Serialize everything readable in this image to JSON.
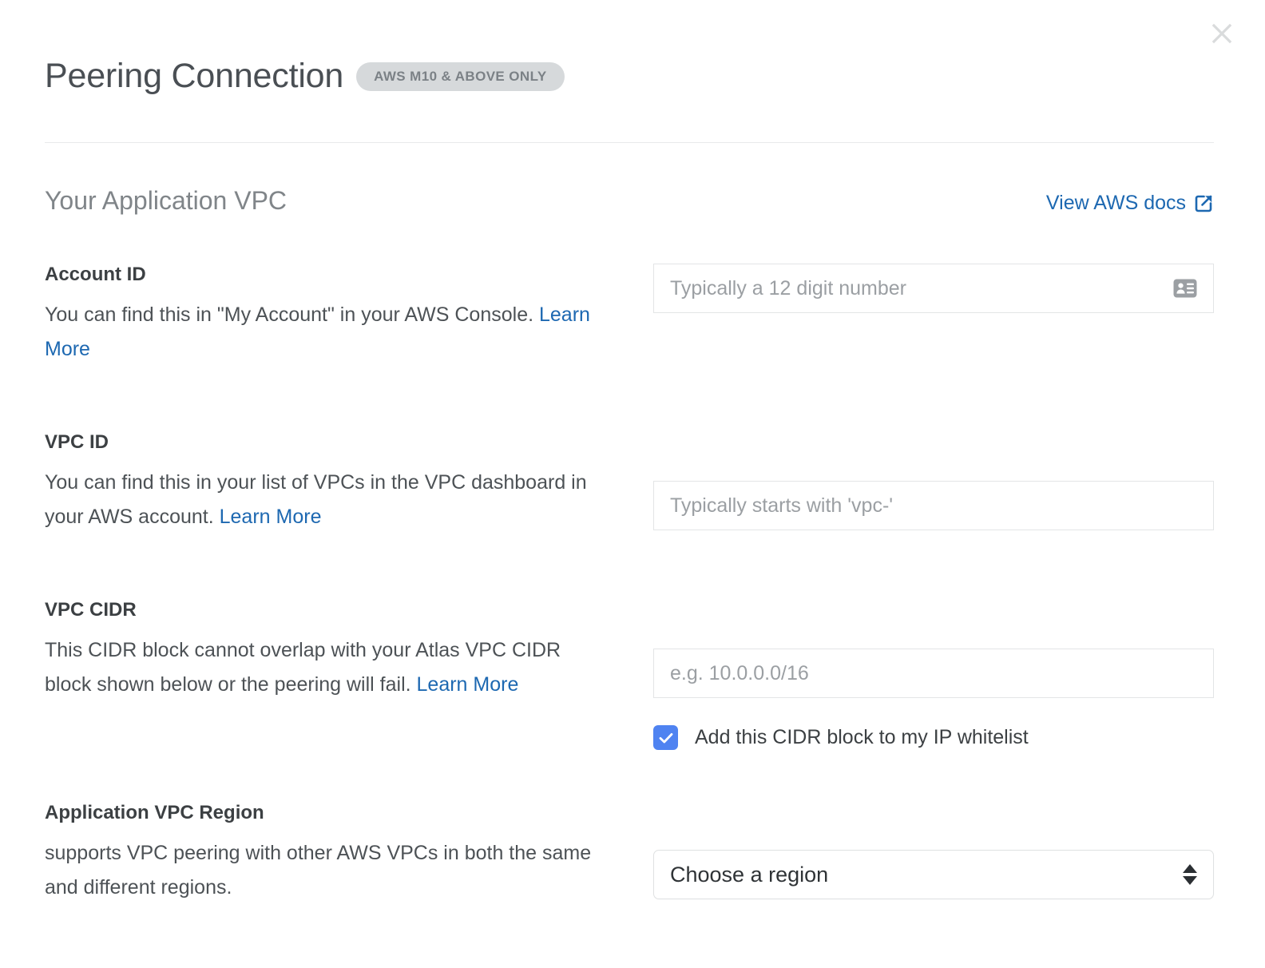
{
  "header": {
    "title": "Peering Connection",
    "badge": "AWS M10 & ABOVE ONLY",
    "close_label": "×"
  },
  "section": {
    "title": "Your Application VPC",
    "docs_link": "View AWS docs"
  },
  "learn_more_label": "Learn More",
  "fields": {
    "account_id": {
      "label": "Account ID",
      "desc_before": "You can find this in \"My Account\" in your AWS Console. ",
      "desc_link": "Learn More",
      "placeholder": "Typically a 12 digit number",
      "value": "",
      "icon": "contact-card-icon"
    },
    "vpc_id": {
      "label": "VPC ID",
      "desc_before": "You can find this in your list of VPCs in the VPC dashboard in your AWS account. ",
      "desc_link": "Learn More",
      "placeholder": "Typically starts with 'vpc-'",
      "value": ""
    },
    "vpc_cidr": {
      "label": "VPC CIDR",
      "desc_before": "This CIDR block cannot overlap with your Atlas VPC CIDR block shown below or the peering will fail. ",
      "desc_link": "Learn More",
      "placeholder": "e.g. 10.0.0.0/16",
      "value": "",
      "checkbox_label": "Add this CIDR block to my IP whitelist",
      "checkbox_checked": true
    },
    "vpc_region": {
      "label": "Application VPC Region",
      "desc": "supports VPC peering with other AWS VPCs in both the same and different regions.",
      "selected": "Choose a region"
    }
  },
  "colors": {
    "link": "#1d68b1",
    "checkbox": "#4f83f1",
    "badge_bg": "#d6d9db",
    "badge_text": "#7b8186"
  }
}
